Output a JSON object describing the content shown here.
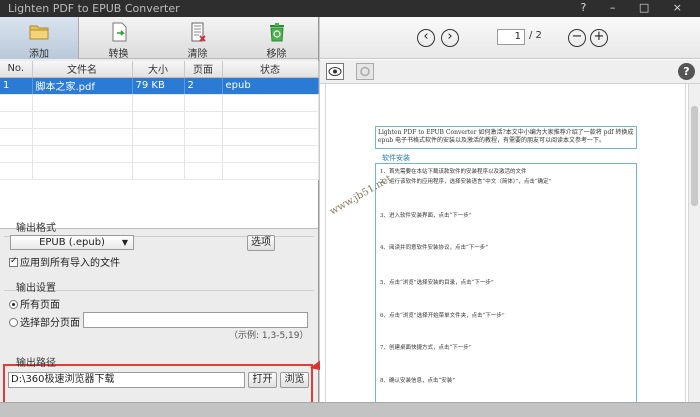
{
  "app": {
    "title": "Lighten PDF to EPUB Converter",
    "window_controls": "? – □ ×"
  },
  "toolbar": {
    "add_label": "添加",
    "convert_label": "转换",
    "clear_label": "清除",
    "remove_label": "移除"
  },
  "table": {
    "columns": [
      "No.",
      "文件名",
      "大小",
      "页面",
      "状态"
    ],
    "rows": [
      {
        "no": "1",
        "name": "脚本之家.pdf",
        "size": "79 KB",
        "pages": "2",
        "status": "epub"
      }
    ]
  },
  "output_format": {
    "section_label": "输出格式",
    "selected": "EPUB (.epub)",
    "options_button": "选项",
    "apply_all_label": "应用到所有导入的文件",
    "apply_all_checked": true
  },
  "output_settings": {
    "section_label": "输出设置",
    "all_pages_label": "所有页面",
    "partial_pages_label": "选择部分页面",
    "page_range_value": "",
    "example_hint": "（示例: 1,3-5,19）",
    "all_pages_selected": true
  },
  "output_path": {
    "section_label": "输出路径",
    "value": "D:\\360极速浏览器下载",
    "open_button": "打开",
    "browse_button": "浏览"
  },
  "preview": {
    "current_page": "1",
    "total_pages": "/ 2",
    "help_icon": "?",
    "doc_header": "Lighten PDF to EPUB Converter 如何激活?本文中小编为大家推荐介绍了一款将 pdf 转换成 epub 电子书格式软件的安装以及激活的教程，有需要的朋友可以阅读本文参考一下。",
    "doc_subtitle": "软件安装",
    "doc_steps": [
      "1、首先需要在本站下载该款软件的安装程序以及激活的文件",
      "2、运行该软件的应用程序，选择安装语言“中文（简体）”，点击“确定”",
      "3、进入软件安装界面，点击“下一步”",
      "4、阅读并同意软件安装协议，点击“下一步”",
      "5、点击“浏览”选择安装的目录，点击“下一步”",
      "6、点击“浏览”选择开始菜单文件夹，点击“下一步”",
      "7、创建桌面快捷方式，点击“下一步”",
      "8、确认安装信息，点击“安装”"
    ],
    "watermark": "www.jb51.net"
  }
}
